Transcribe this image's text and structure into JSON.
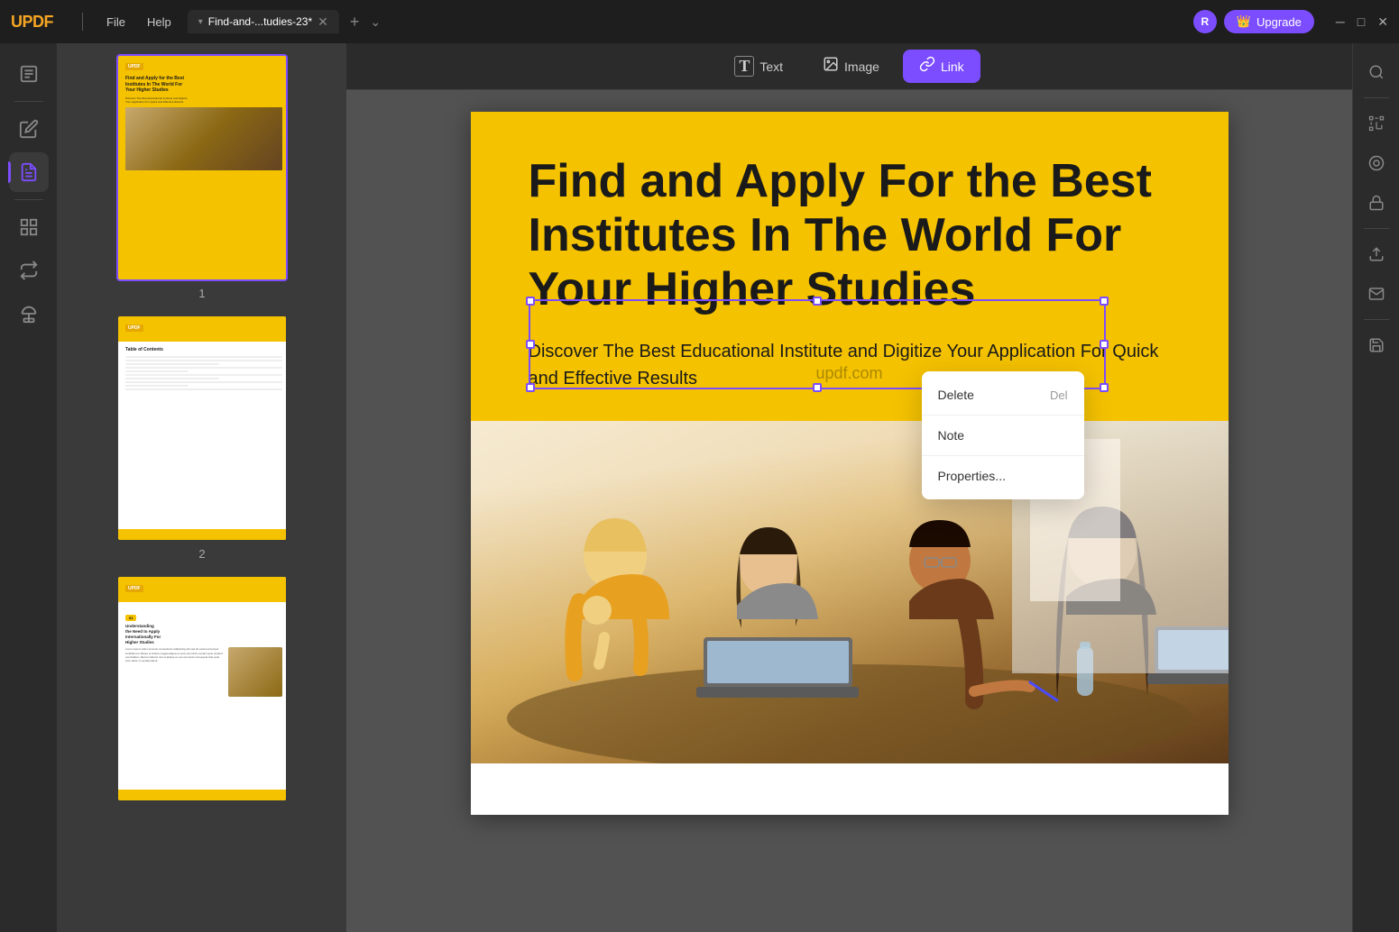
{
  "app": {
    "name": "UPDF",
    "logo_text": "UPDF"
  },
  "titlebar": {
    "menu_items": [
      "File",
      "Help"
    ],
    "tab_label": "Find-and-...tudies-23*",
    "tab_modified": true,
    "upgrade_label": "Upgrade"
  },
  "left_sidebar": {
    "icons": [
      {
        "name": "document-icon",
        "symbol": "☰",
        "active": false
      },
      {
        "name": "edit-icon",
        "symbol": "✏",
        "active": false
      },
      {
        "name": "annotate-icon",
        "symbol": "📝",
        "active": true
      },
      {
        "name": "organize-icon",
        "symbol": "⊞",
        "active": false
      },
      {
        "name": "convert-icon",
        "symbol": "⇄",
        "active": false
      },
      {
        "name": "stamp-icon",
        "symbol": "◈",
        "active": false
      }
    ]
  },
  "toolbar": {
    "buttons": [
      {
        "label": "Text",
        "icon": "T",
        "active": false
      },
      {
        "label": "Image",
        "icon": "🖼",
        "active": false
      },
      {
        "label": "Link",
        "icon": "🔗",
        "active": true
      }
    ]
  },
  "pdf": {
    "title": "Find and Apply For the Best Institutes In The World For Your Higher Studies",
    "subtitle": "Discover The Best Educational Institute and Digitize Your Application For Quick and Effective Results",
    "watermark": "updf.com",
    "current_page": 1,
    "total_pages": 3
  },
  "context_menu": {
    "items": [
      {
        "label": "Delete",
        "shortcut": "Del"
      },
      {
        "label": "Note",
        "shortcut": ""
      },
      {
        "label": "Properties...",
        "shortcut": ""
      }
    ]
  },
  "thumbnails": [
    {
      "page": 1,
      "label": "1"
    },
    {
      "page": 2,
      "label": "2"
    },
    {
      "page": 3,
      "label": ""
    }
  ],
  "right_sidebar": {
    "icons": [
      {
        "name": "search-icon",
        "symbol": "🔍"
      },
      {
        "name": "ocr-icon",
        "symbol": "OCR"
      },
      {
        "name": "extract-icon",
        "symbol": "◎"
      },
      {
        "name": "protect-icon",
        "symbol": "🔒"
      },
      {
        "name": "share-icon",
        "symbol": "↑"
      },
      {
        "name": "email-icon",
        "symbol": "✉"
      },
      {
        "name": "save-icon",
        "symbol": "💾"
      }
    ]
  }
}
